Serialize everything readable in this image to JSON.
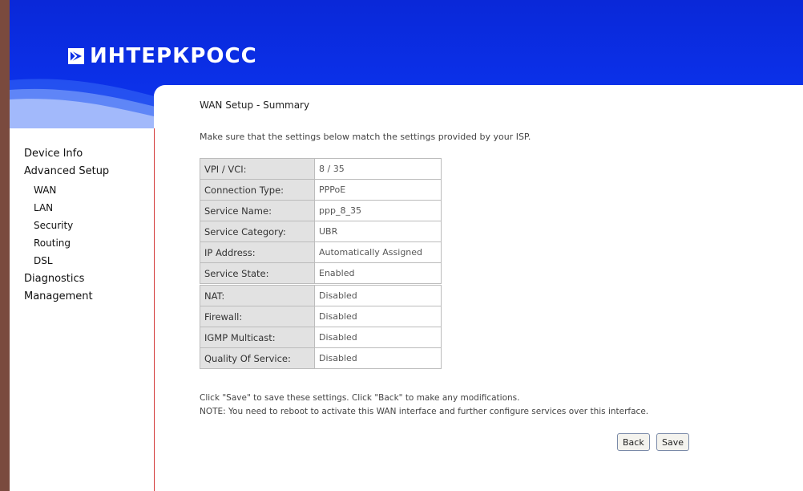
{
  "brand": {
    "name": "ИНТЕРКРОСС"
  },
  "sidebar": {
    "items": [
      {
        "label": "Device Info",
        "level": 0
      },
      {
        "label": "Advanced Setup",
        "level": 0
      },
      {
        "label": "WAN",
        "level": 1
      },
      {
        "label": "LAN",
        "level": 1
      },
      {
        "label": "Security",
        "level": 1
      },
      {
        "label": "Routing",
        "level": 1
      },
      {
        "label": "DSL",
        "level": 1
      },
      {
        "label": "Diagnostics",
        "level": 0
      },
      {
        "label": "Management",
        "level": 0
      }
    ]
  },
  "main": {
    "title": "WAN Setup - Summary",
    "intro": "Make sure that the settings below match the settings provided by your ISP.",
    "summary": [
      {
        "label": "VPI / VCI:",
        "value": "8 / 35"
      },
      {
        "label": "Connection Type:",
        "value": "PPPoE"
      },
      {
        "label": "Service Name:",
        "value": "ppp_8_35"
      },
      {
        "label": "Service Category:",
        "value": "UBR"
      },
      {
        "label": "IP Address:",
        "value": "Automatically Assigned"
      },
      {
        "label": "Service State:",
        "value": "Enabled"
      },
      {
        "label": "NAT:",
        "value": "Disabled"
      },
      {
        "label": "Firewall:",
        "value": "Disabled"
      },
      {
        "label": "IGMP Multicast:",
        "value": "Disabled"
      },
      {
        "label": "Quality Of Service:",
        "value": "Disabled"
      }
    ],
    "note_line1": "Click \"Save\" to save these settings. Click \"Back\" to make any modifications.",
    "note_line2": "NOTE: You need to reboot to activate this WAN interface and further configure services over this interface.",
    "back_label": "Back",
    "save_label": "Save"
  },
  "colors": {
    "banner": "#0b2fe6",
    "left_strip": "#7a4a3e",
    "sidebar_border": "#d33a3a",
    "label_cell": "#e2e2e2"
  }
}
